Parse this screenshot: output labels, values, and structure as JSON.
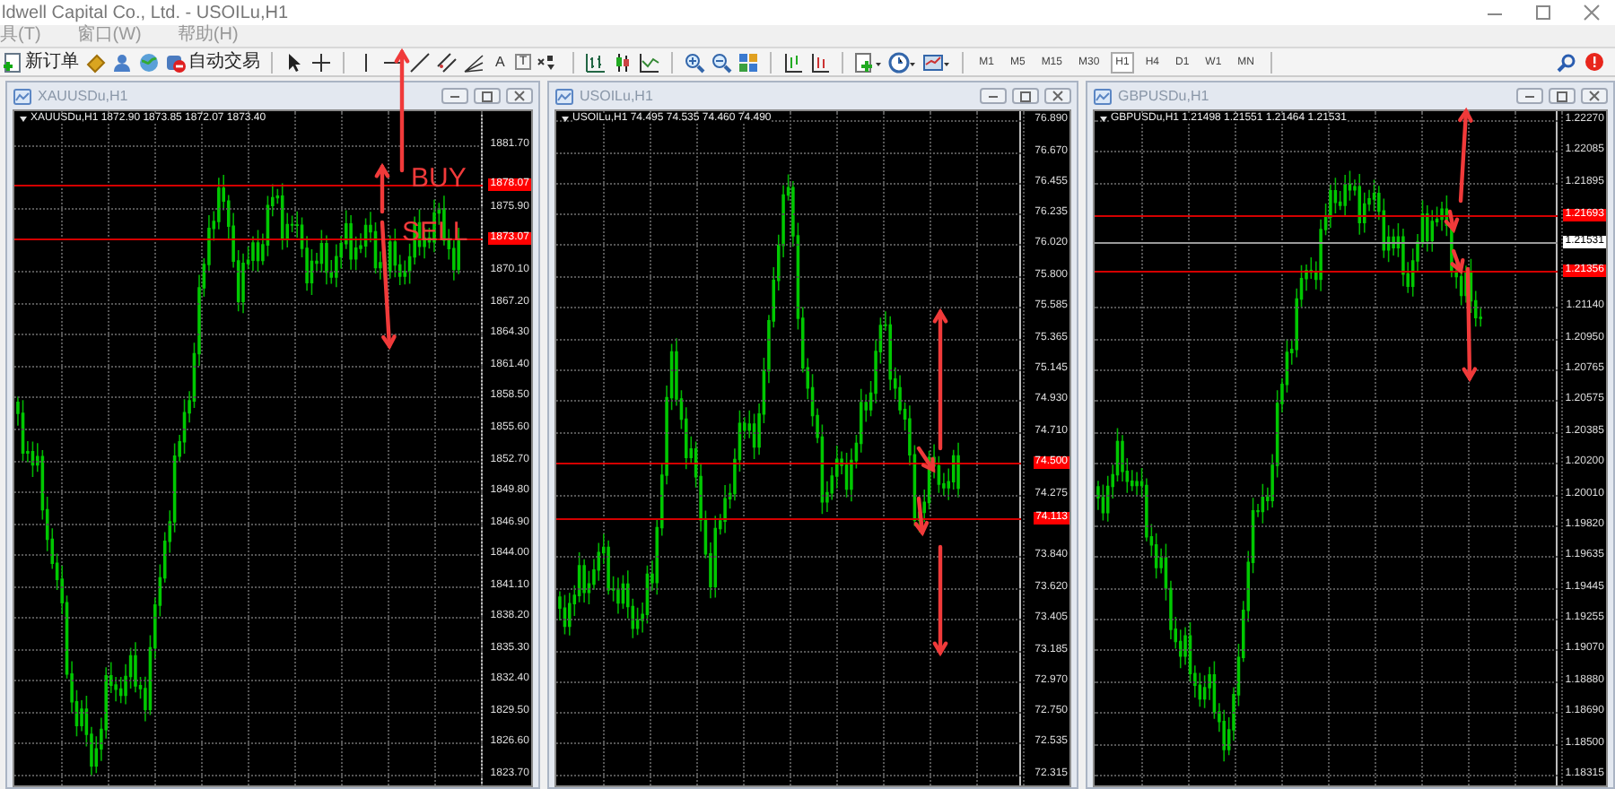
{
  "title_bar": {
    "title": "ldwell Capital Co., Ltd. - USOILu,H1"
  },
  "menu": [
    {
      "label": "具(T)"
    },
    {
      "label": "窗口(W)"
    },
    {
      "label": "帮助(H)"
    }
  ],
  "toolbar": {
    "new_order": "新订单",
    "auto_trading": "自动交易",
    "text_tool": "A",
    "label_tool": "T",
    "timeframes": [
      {
        "label": "M1",
        "selected": false
      },
      {
        "label": "M5",
        "selected": false
      },
      {
        "label": "M15",
        "selected": false
      },
      {
        "label": "M30",
        "selected": false
      },
      {
        "label": "H1",
        "selected": true
      },
      {
        "label": "H4",
        "selected": false
      },
      {
        "label": "D1",
        "selected": false
      },
      {
        "label": "W1",
        "selected": false
      },
      {
        "label": "MN",
        "selected": false
      }
    ]
  },
  "charts": [
    {
      "window_title": "XAUUSDu,H1",
      "header": "XAUUSDu,H1 1872.90 1873.85 1872.07 1873.40",
      "axis_labels": [
        "1881.70",
        "1875.90",
        "1870.10",
        "1867.20",
        "1864.30",
        "1861.40",
        "1858.50",
        "1855.60",
        "1852.70",
        "1849.80",
        "1846.90",
        "1844.00",
        "1841.10",
        "1838.20",
        "1835.30",
        "1832.40",
        "1829.50",
        "1826.60",
        "1823.70"
      ],
      "price_tags": [
        {
          "price": "1878.07",
          "kind": "order"
        },
        {
          "price": "1873.07",
          "kind": "order"
        }
      ],
      "annotations": [
        {
          "text": "BUY"
        },
        {
          "text": "SELL"
        }
      ]
    },
    {
      "window_title": "USOILu,H1",
      "header": "USOILu,H1 74.495 74.535 74.460 74.490",
      "axis_labels": [
        "76.890",
        "76.670",
        "76.455",
        "76.235",
        "76.020",
        "75.800",
        "75.585",
        "75.365",
        "75.145",
        "74.930",
        "74.710",
        "74.275",
        "73.840",
        "73.620",
        "73.405",
        "73.185",
        "72.970",
        "72.750",
        "72.535",
        "72.315"
      ],
      "price_tags": [
        {
          "price": "74.500",
          "kind": "order"
        },
        {
          "price": "74.113",
          "kind": "order"
        }
      ]
    },
    {
      "window_title": "GBPUSDu,H1",
      "header": "GBPUSDu,H1 1.21498 1.21551 1.21464 1.21531",
      "axis_labels": [
        "1.22270",
        "1.22085",
        "1.21895",
        "1.21140",
        "1.20950",
        "1.20765",
        "1.20575",
        "1.20385",
        "1.20200",
        "1.20010",
        "1.19820",
        "1.19635",
        "1.19445",
        "1.19255",
        "1.19070",
        "1.18880",
        "1.18690",
        "1.18500",
        "1.18315"
      ],
      "price_tags": [
        {
          "price": "1.21693",
          "kind": "order"
        },
        {
          "price": "1.21531",
          "kind": "bid"
        },
        {
          "price": "1.21356",
          "kind": "order"
        }
      ]
    }
  ]
}
